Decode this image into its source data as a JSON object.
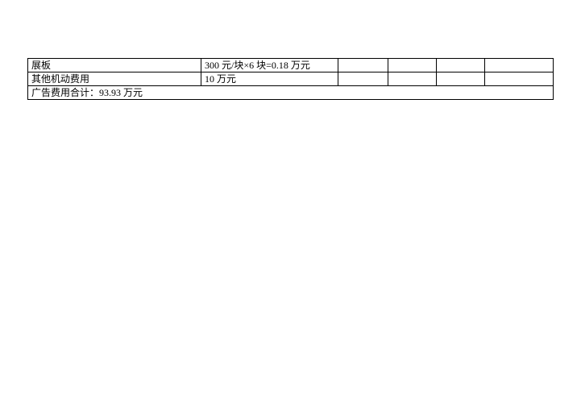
{
  "table": {
    "rows": [
      {
        "c1": "展板",
        "c2": "300 元/块×6 块=0.18 万元",
        "c3": "",
        "c4": "",
        "c5": "",
        "c6": ""
      },
      {
        "c1": "其他机动费用",
        "c2": "10 万元",
        "c3": "",
        "c4": "",
        "c5": "",
        "c6": ""
      }
    ],
    "total": "广告费用合计：93.93 万元"
  }
}
